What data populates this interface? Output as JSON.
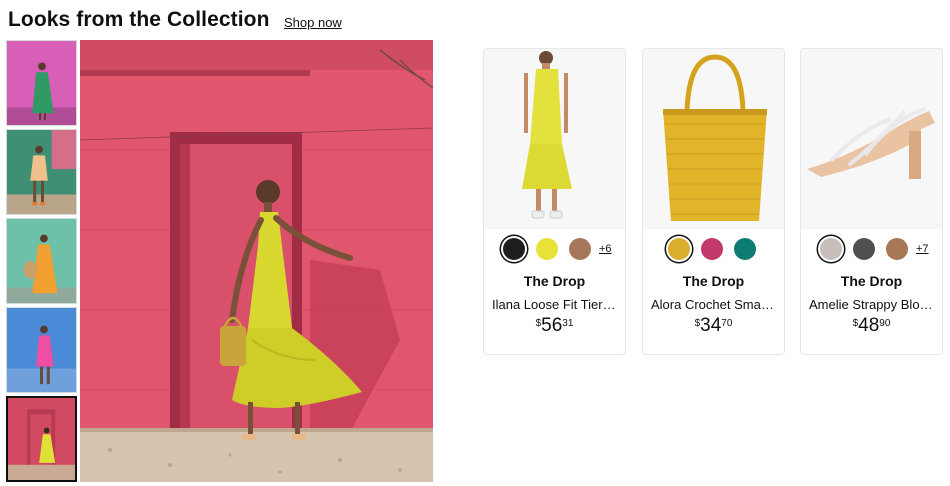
{
  "section": {
    "title": "Looks from the Collection",
    "shop_link": "Shop now"
  },
  "gallery": {
    "thumbnails": [
      {
        "name": "look-1-thumbnail",
        "selected": false
      },
      {
        "name": "look-2-thumbnail",
        "selected": false
      },
      {
        "name": "look-3-thumbnail",
        "selected": false
      },
      {
        "name": "look-4-thumbnail",
        "selected": false
      },
      {
        "name": "look-5-thumbnail",
        "selected": true
      }
    ]
  },
  "products": [
    {
      "brand": "The Drop",
      "name": "Ilana Loose Fit Tiered Maxi Dress",
      "price_symbol": "$",
      "price_whole": "56",
      "price_fraction": "31",
      "swatches": [
        "#1f1f1f",
        "#e6e23a",
        "#a6775a"
      ],
      "selected_swatch": 0,
      "more_colors": "+6"
    },
    {
      "brand": "The Drop",
      "name": "Alora Crochet Small Tote Bag",
      "price_symbol": "$",
      "price_whole": "34",
      "price_fraction": "70",
      "swatches": [
        "#d9ad2e",
        "#c2386b",
        "#0d7d73"
      ],
      "selected_swatch": 0,
      "more_colors": ""
    },
    {
      "brand": "The Drop",
      "name": "Amelie Strappy Block Heel Sandal",
      "price_symbol": "$",
      "price_whole": "48",
      "price_fraction": "90",
      "swatches": [
        "#c7bebb",
        "#4f4f4f",
        "#a87756"
      ],
      "selected_swatch": 0,
      "more_colors": "+7"
    }
  ]
}
